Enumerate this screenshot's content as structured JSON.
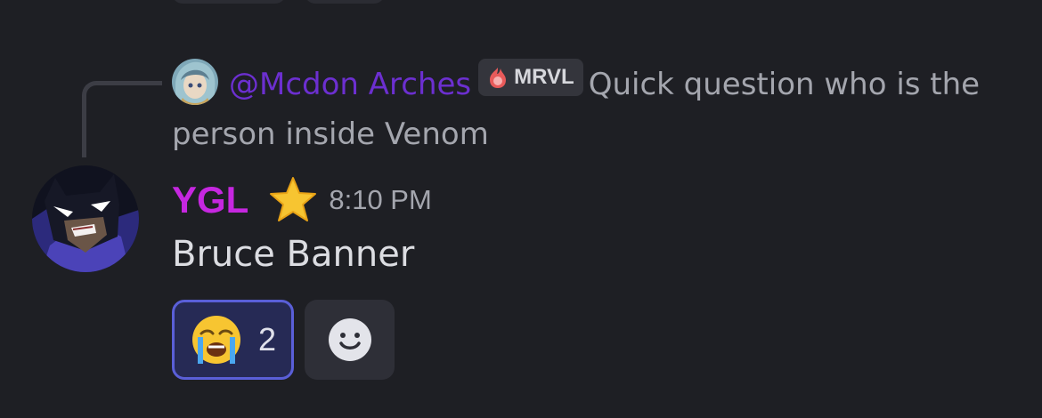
{
  "reply": {
    "author": "@Mcdon Arches",
    "role_tag": "MRVL",
    "text": "Quick question who is the person inside Venom",
    "avatar_icon": "anime-character-avatar-icon",
    "role_icon": "flame-role-icon"
  },
  "message": {
    "author": "YGL",
    "author_color": "#c627e0",
    "badge_icon": "star-icon",
    "timestamp": "8:10 PM",
    "text": "Bruce Banner",
    "avatar_icon": "batman-avatar-icon"
  },
  "reactions": [
    {
      "emoji_icon": "loudly-crying-face-icon",
      "count": "2",
      "selected": true
    }
  ],
  "add_reaction": {
    "icon": "smiley-face-icon"
  },
  "colors": {
    "background": "#1e1f24",
    "reply_author": "#6c2fd0",
    "reaction_border": "#5a5fd8"
  }
}
